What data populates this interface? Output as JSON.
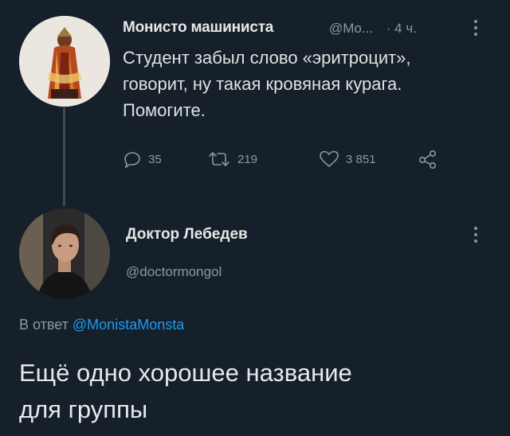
{
  "tweet": {
    "author_name": "Монисто машиниста",
    "author_handle": "@Mo...",
    "time": "· 4 ч.",
    "text_lines": [
      "Студент забыл слово «эритроцит»,",
      "говорит, ну такая кровяная курага.",
      "Помогите."
    ],
    "actions": {
      "replies": "35",
      "retweets": "219",
      "likes": "3 851"
    }
  },
  "reply_tweet": {
    "author_name": "Доктор Лебедев",
    "author_handle": "@doctormongol",
    "reply_prefix": "В ответ",
    "reply_mention": "@MonistaMonsta",
    "text_lines": [
      "Ещё одно хорошее название",
      "для группы"
    ]
  },
  "colors": {
    "background": "#15202b",
    "accent": "#1d9bf0",
    "muted": "#8a97a2"
  },
  "icons": [
    "more-icon",
    "reply-icon",
    "retweet-icon",
    "like-icon",
    "share-icon"
  ]
}
